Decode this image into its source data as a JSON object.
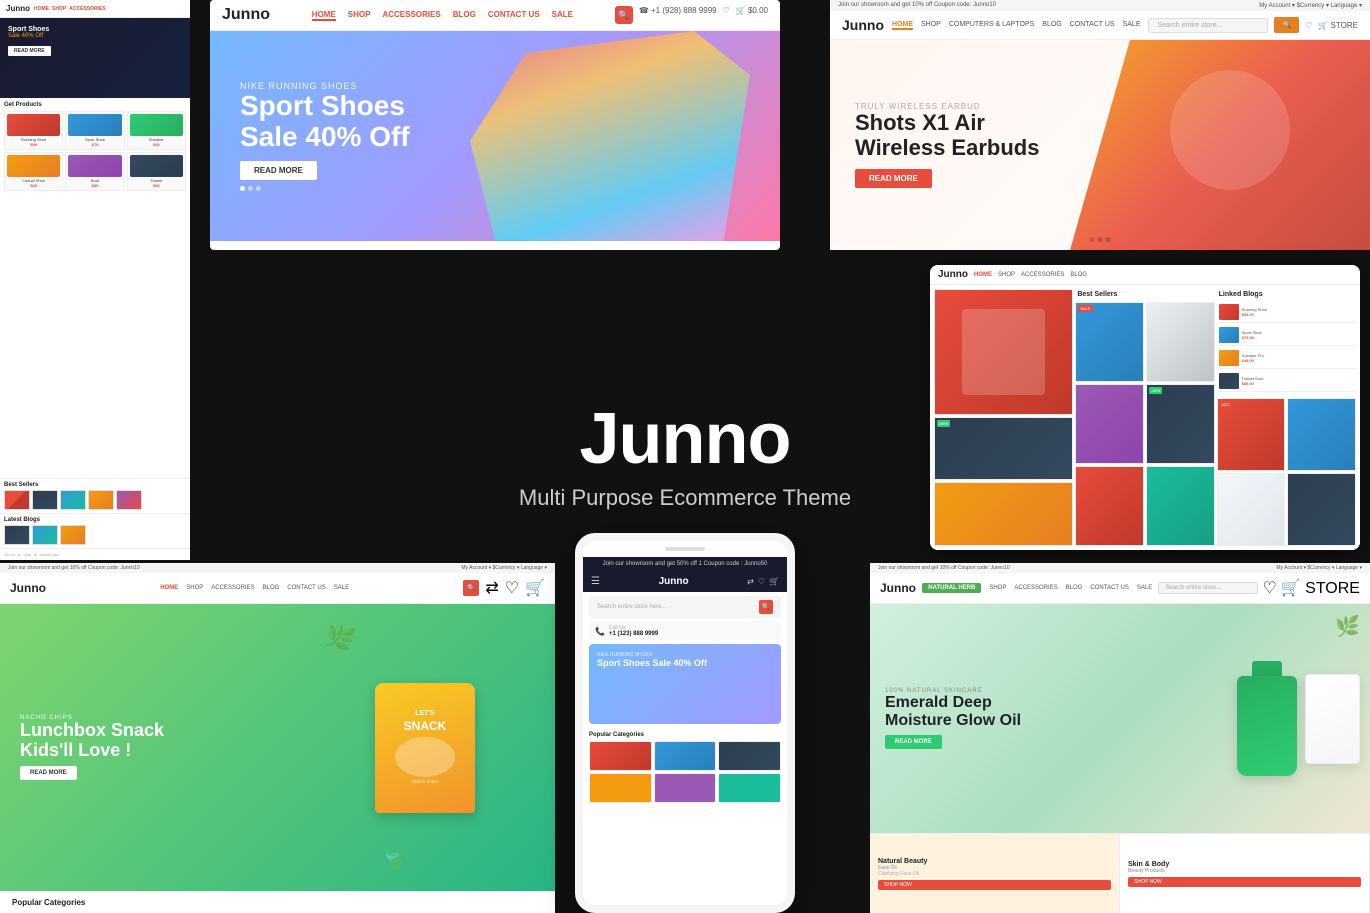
{
  "theme": {
    "name": "Junno",
    "tagline": "Multi Purpose Ecommerce Theme",
    "brand_color": "#e74c3c",
    "dark_bg": "#111111"
  },
  "center": {
    "title": "Junno",
    "subtitle": "Multi Purpose Ecommerce Theme"
  },
  "top_left_screenshot": {
    "logo": "Junno",
    "hero_eyebrow": "Sport Shoes",
    "hero_title": "Sale 40% Off",
    "section_title": "Get Products"
  },
  "top_center_screenshot": {
    "logo": "Junno",
    "nav": [
      "HOME",
      "SHOP",
      "ACCESSORIES",
      "BLOG",
      "CONTACT US",
      "SALE"
    ],
    "hero_eyebrow": "NIKE RUNNING SHOES",
    "hero_title": "Sport Shoes",
    "hero_subtitle": "Sale 40% Off",
    "hero_btn": "READ MORE"
  },
  "top_right_screenshot": {
    "logo": "Junno",
    "nav": [
      "HOME",
      "SHOP",
      "COMPUTERS & LAPTOPS",
      "BLOG",
      "CONTACT US",
      "SALE"
    ],
    "hero_eyebrow": "TRULY WIRELESS EARBUD",
    "hero_title": "Shots X1 Air",
    "hero_subtitle": "Wireless Earbuds",
    "hero_btn": "READ MORE"
  },
  "mid_right_tablet": {
    "logo": "Junno",
    "section_title": "Best Sellers"
  },
  "bot_left_screenshot": {
    "logo": "Junno",
    "nav": [
      "HOME",
      "SHOP",
      "ACCESSORIES",
      "BLOG",
      "CONTACT US",
      "SALE"
    ],
    "hero_eyebrow": "NACHO CHIPS",
    "hero_title": "Lunchbox Snack",
    "hero_subtitle": "Kids'll Love !",
    "snack_text": "LET'S SNACK",
    "hero_btn": "READ MORE"
  },
  "bot_center_phone": {
    "logo": "Junno",
    "banner_text": "Join our showroom and get 50% off 1 Coupon code : Junno50",
    "search_placeholder": "Search entire store here...",
    "call_label": "Call Us:",
    "call_number": "+1 (123) 888 9999",
    "hero_eyebrow": "NIKE RUNNING SHOES",
    "hero_title": "Sport Shoes Sale 40% Off",
    "categories_title": "Popular Categories"
  },
  "bot_right_screenshot": {
    "logo": "Junno",
    "nav_btn": "NATURAL HERB",
    "hero_eyebrow": "100% NATURAL SKINCARE",
    "hero_title": "Emerald Deep",
    "hero_subtitle": "Moisture Glow Oil",
    "hero_btn": "READ MORE",
    "card1_title": "Natural Beauty",
    "card1_sub": "Face Oil",
    "card1_desc": "Clarifying Face Oil",
    "card1_btn": "SHOP NOW",
    "card2_title": "Skin & Body",
    "card2_btn": "SHOP NOW"
  }
}
